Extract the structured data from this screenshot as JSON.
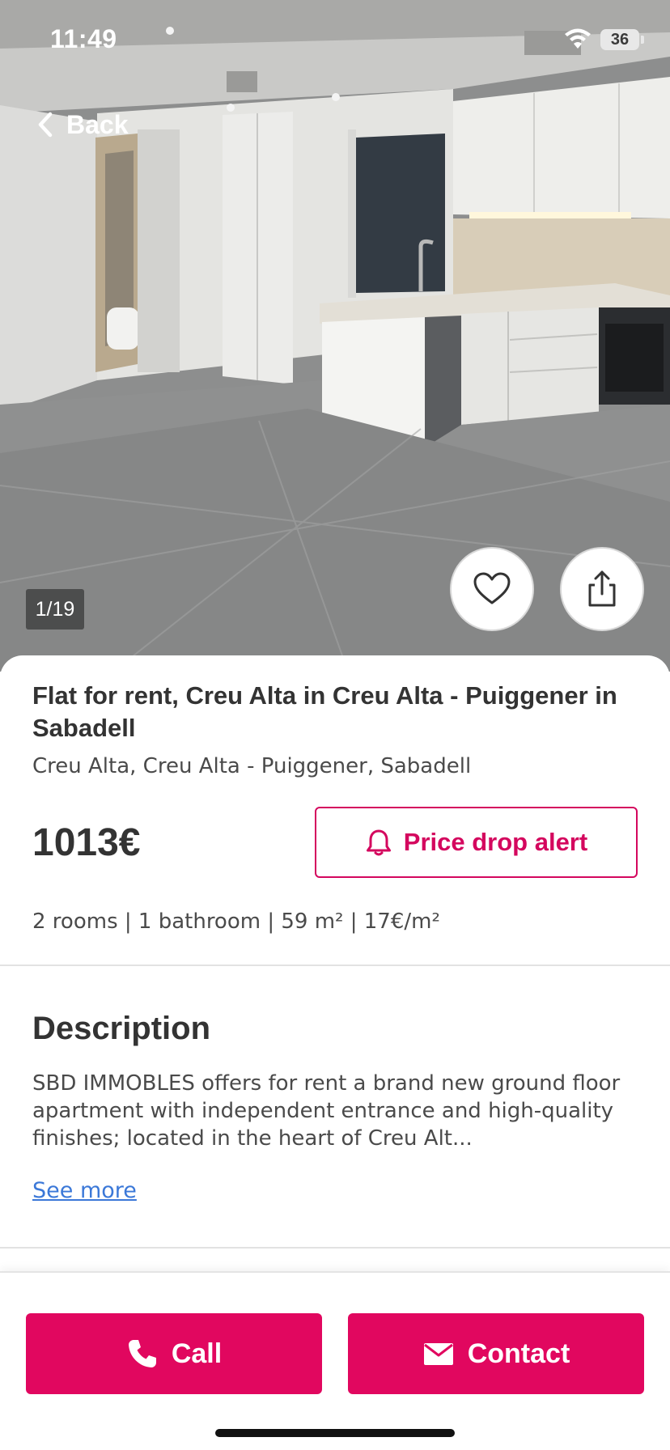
{
  "status_bar": {
    "time": "11:49",
    "battery": "36",
    "wifi_icon": "wifi-icon"
  },
  "nav": {
    "back_label": "Back",
    "back_icon": "chevron-left-icon"
  },
  "gallery": {
    "counter": "1/19",
    "favorite_icon": "heart-icon",
    "share_icon": "share-icon"
  },
  "listing": {
    "title": "Flat for rent, Creu Alta in Creu Alta - Puiggener in Sabadell",
    "address": "Creu Alta, Creu Alta - Puiggener, Sabadell",
    "price": "1013€",
    "features": "2 rooms | 1 bathroom | 59 m² | 17€/m²"
  },
  "alert": {
    "label": "Price drop alert",
    "icon": "bell-icon"
  },
  "description": {
    "heading": "Description",
    "text": "SBD IMMOBLES offers for rent a brand new ground floor apartment with independent entrance and high-quality finishes; located in the heart of Creu Alt...",
    "see_more": "See more"
  },
  "actions": {
    "call_label": "Call",
    "call_icon": "phone-icon",
    "contact_label": "Contact",
    "contact_icon": "mail-icon"
  },
  "colors": {
    "brand": "#e1075f",
    "link": "#3b78d8",
    "text": "#333333"
  }
}
